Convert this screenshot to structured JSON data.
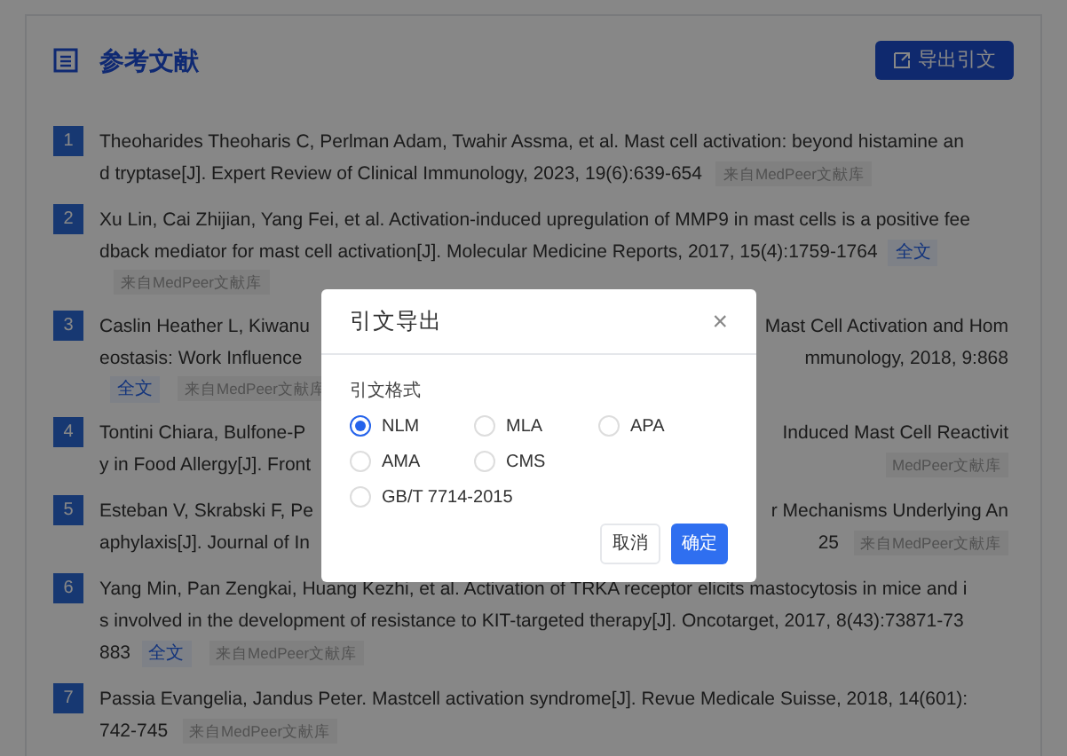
{
  "section": {
    "title": "参考文献",
    "export_button": "导出引文"
  },
  "references": [
    {
      "number": "1",
      "lines": [
        [
          {
            "kind": "text",
            "text": "Theoharides Theoharis C, Perlman Adam, Twahir Assma, et al. Mast cell activation: beyond histamine an"
          }
        ],
        [
          {
            "kind": "text",
            "text": "d tryptase[J]. Expert Review of Clinical Immunology, 2023, 19(6):639-654"
          },
          {
            "kind": "tag",
            "text": "来自MedPeer文献库"
          }
        ]
      ]
    },
    {
      "number": "2",
      "lines": [
        [
          {
            "kind": "text",
            "text": "Xu Lin, Cai Zhijian, Yang Fei, et al. Activation-induced upregulation of MMP9 in mast cells is a positive fee"
          }
        ],
        [
          {
            "kind": "text",
            "text": "dback mediator for mast cell activation[J]. Molecular Medicine Reports, 2017, 15(4):1759-1764"
          },
          {
            "kind": "link",
            "text": "全文"
          }
        ],
        [
          {
            "kind": "tag",
            "text": "来自MedPeer文献库"
          }
        ]
      ]
    },
    {
      "number": "3",
      "lines": [
        [
          {
            "kind": "text",
            "text": "Caslin Heather L, Kiwanu"
          },
          {
            "kind": "gap"
          },
          {
            "kind": "text",
            "text": "Mast Cell Activation and Hom"
          }
        ],
        [
          {
            "kind": "text",
            "text": "eostasis: Work Influence"
          },
          {
            "kind": "gap"
          },
          {
            "kind": "text",
            "text": "mmunology, 2018, 9:868"
          }
        ],
        [
          {
            "kind": "link",
            "text": "全文"
          },
          {
            "kind": "tag",
            "text": "来自MedPeer文献库"
          }
        ]
      ]
    },
    {
      "number": "4",
      "lines": [
        [
          {
            "kind": "text",
            "text": "Tontini Chiara, Bulfone-P"
          },
          {
            "kind": "gap"
          },
          {
            "kind": "text",
            "text": "Induced Mast Cell Reactivit"
          }
        ],
        [
          {
            "kind": "text",
            "text": "y in Food Allergy[J]. Front"
          },
          {
            "kind": "gap"
          },
          {
            "kind": "tag",
            "text": "MedPeer文献库"
          }
        ]
      ]
    },
    {
      "number": "5",
      "lines": [
        [
          {
            "kind": "text",
            "text": "Esteban V, Skrabski F, Pe"
          },
          {
            "kind": "gap"
          },
          {
            "kind": "text",
            "text": "r Mechanisms Underlying An"
          }
        ],
        [
          {
            "kind": "text",
            "text": "aphylaxis[J]. Journal of In"
          },
          {
            "kind": "gap"
          },
          {
            "kind": "text",
            "text": "25"
          },
          {
            "kind": "tag",
            "text": "来自MedPeer文献库"
          }
        ]
      ]
    },
    {
      "number": "6",
      "lines": [
        [
          {
            "kind": "text",
            "text": "Yang Min, Pan Zengkai, Huang Kezhi, et al. Activation of TRKA receptor elicits mastocytosis in mice and i"
          }
        ],
        [
          {
            "kind": "text",
            "text": "s involved in the development of resistance to KIT-targeted therapy[J]. Oncotarget, 2017, 8(43):73871-73"
          }
        ],
        [
          {
            "kind": "text",
            "text": "883"
          },
          {
            "kind": "link",
            "text": "全文"
          },
          {
            "kind": "tag",
            "text": "来自MedPeer文献库"
          }
        ]
      ]
    },
    {
      "number": "7",
      "lines": [
        [
          {
            "kind": "text",
            "text": "Passia Evangelia, Jandus Peter. Mastcell activation syndrome[J]. Revue Medicale Suisse, 2018, 14(601):"
          }
        ],
        [
          {
            "kind": "text",
            "text": "742-745"
          },
          {
            "kind": "tag",
            "text": "来自MedPeer文献库"
          }
        ]
      ]
    }
  ],
  "dialog": {
    "title": "引文导出",
    "close": "×",
    "format_label": "引文格式",
    "options": [
      {
        "label": "NLM",
        "selected": true
      },
      {
        "label": "MLA",
        "selected": false
      },
      {
        "label": "APA",
        "selected": false
      },
      {
        "label": "AMA",
        "selected": false
      },
      {
        "label": "CMS",
        "selected": false
      },
      {
        "label": "GB/T 7714-2015",
        "selected": false
      }
    ],
    "cancel": "取消",
    "confirm": "确定"
  }
}
